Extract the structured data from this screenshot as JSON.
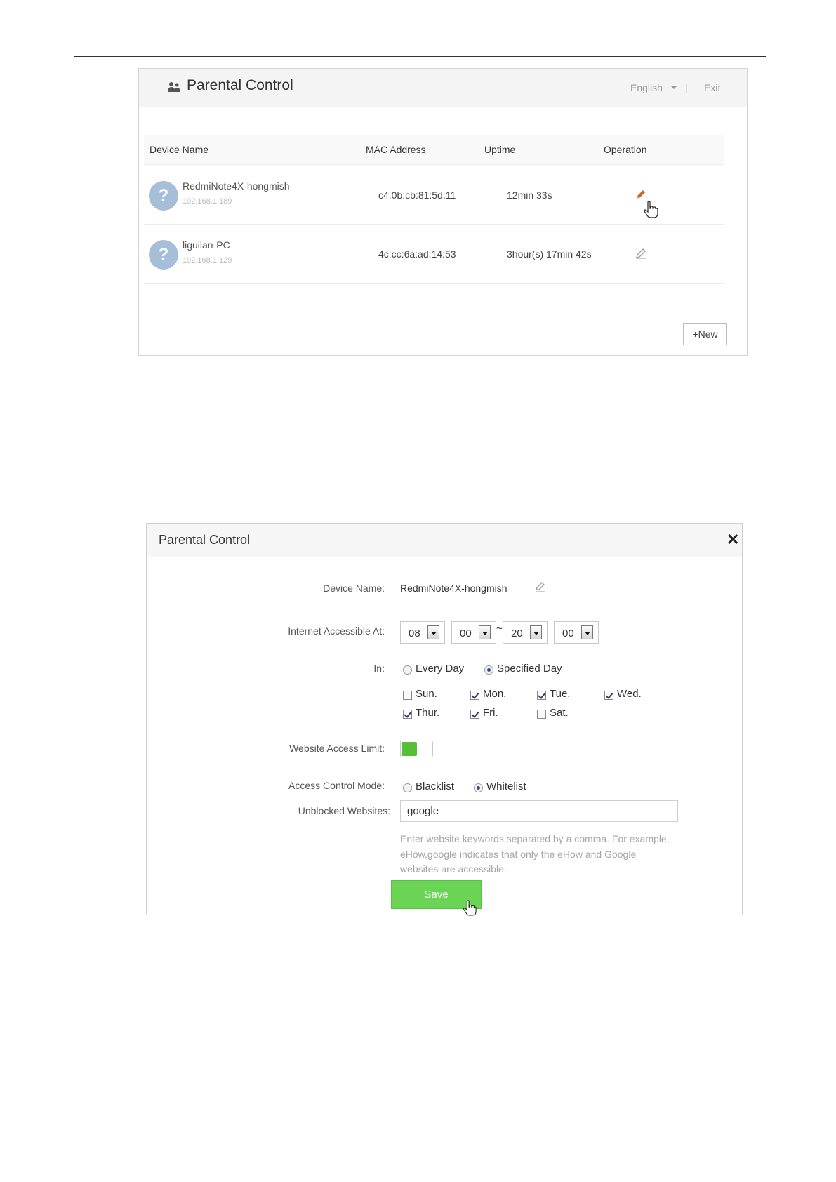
{
  "device_list": {
    "title": "Parental Control",
    "language": "English",
    "separator": "|",
    "exit_label": "Exit",
    "columns": [
      "Device Name",
      "MAC Address",
      "Uptime",
      "Operation"
    ],
    "rows": [
      {
        "name": "RedmiNote4X-hongmish",
        "ip": "192.168.1.189",
        "mac": "c4:0b:cb:81:5d:11",
        "uptime": "12min 33s",
        "avatar": "?"
      },
      {
        "name": "liguilan-PC",
        "ip": "192.168.1.129",
        "mac": "4c:cc:6a:ad:14:53",
        "uptime": "3hour(s) 17min 42s",
        "avatar": "?"
      }
    ],
    "new_label": "+New",
    "edit_color_active": "#c56a2b",
    "edit_color_idle": "#999999"
  },
  "dialog": {
    "title": "Parental Control",
    "close_glyph": "✕",
    "device_name_label": "Device Name:",
    "device_name_value": "RedmiNote4X-hongmish",
    "internet_label": "Internet Accessible At:",
    "time": {
      "start_hour": "08",
      "start_min": "00",
      "tilde": "~",
      "end_hour": "20",
      "end_min": "00"
    },
    "in_label": "In:",
    "schedule_options": [
      {
        "label": "Every Day",
        "selected": false
      },
      {
        "label": "Specified Day",
        "selected": true
      }
    ],
    "days": [
      {
        "label": "Sun.",
        "checked": false
      },
      {
        "label": "Mon.",
        "checked": true
      },
      {
        "label": "Tue.",
        "checked": true
      },
      {
        "label": "Wed.",
        "checked": true
      },
      {
        "label": "Thur.",
        "checked": true
      },
      {
        "label": "Fri.",
        "checked": true
      },
      {
        "label": "Sat.",
        "checked": false
      }
    ],
    "website_limit_label": "Website Access Limit:",
    "website_limit_on": true,
    "mode_label": "Access Control Mode:",
    "modes": [
      {
        "label": "Blacklist",
        "selected": false
      },
      {
        "label": "Whitelist",
        "selected": true
      }
    ],
    "sites_label": "Unblocked Websites:",
    "sites_value": "google",
    "hint": "Enter website keywords separated by a comma. For example, eHow,google indicates that only the eHow and Google websites are accessible.",
    "save_label": "Save",
    "accent_color": "#6ad554"
  }
}
